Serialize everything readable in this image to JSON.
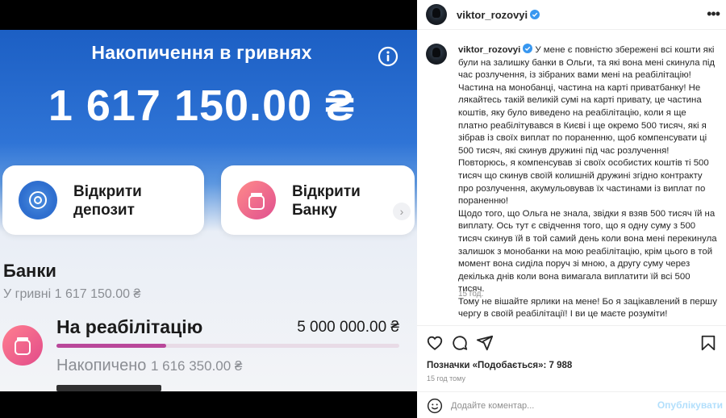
{
  "photo": {
    "title": "Накопичення в гривнях",
    "total": "1 617 150.00 ₴",
    "cards": [
      {
        "label_line1": "Відкрити",
        "label_line2": "депозит"
      },
      {
        "label_line1": "Відкрити",
        "label_line2": "Банку"
      }
    ],
    "jars_heading": "Банки",
    "jars_sub": "У гривні 1 617 150.00 ₴",
    "jar": {
      "name": "На реабілітацію",
      "goal": "5 000 000.00 ₴",
      "saved_label": "Накопичено",
      "saved_value": "1 616 350.00 ₴",
      "progress_fraction": 0.32
    }
  },
  "post": {
    "username": "viktor_rozovyi",
    "caption_lines": [
      "У мене є повністю збережені всі кошти які були на залишку банки в Ольги, та які вона мені скинула під час розлучення, із зібраних вами мені на реабілітацію!",
      "Частина на монобанці, частина на карті приватбанку! Не лякайтесь такій великій сумі на карті привату, це частина коштів, яку було виведено на реабілітацію, коли я ще платно реабілітувався в Києві і ще окремо 500 тисяч, які я зібрав із своїх виплат по пораненню, щоб компенсувати ці 500 тисяч, які скинув дружині під час розлучення!",
      "Повторюсь, я компенсував зі своїх особистих коштів ті 500 тисяч що скинув своїй колишній дружині згідно контракту про розлучення, акумульовував їх частинами із виплат по пораненню!",
      "Щодо того, що Ольга не знала, звідки я взяв 500 тисяч їй на виплату. Ось тут є свідчення того, що я одну суму з 500 тисяч скинув їй в той самий день коли вона мені перекинула залишок з монобанки на мою реабілітацію, крім цього в той момент вона сиділа поруч зі мною, а другу суму через декілька днів коли вона вимагала виплатити їй всі 500 тисяч.",
      "Тому не вішайте ярлики на мене! Бо я зацікавлений в першу чергу в своїй реабілітації! І ви це маєте розуміти!"
    ],
    "caption_age": "15 год.",
    "likes": "Позначки «Подобається»: 7 988",
    "date": "15 год тому",
    "comment_placeholder": "Додайте коментар...",
    "publish_label": "Опублікувати",
    "colors": {
      "verified": "#3897f0",
      "publish": "#b2dffc",
      "accent_blue": "#2f74d6"
    },
    "icons": [
      "heart-icon",
      "comment-icon",
      "share-icon",
      "bookmark-icon",
      "emoji-icon",
      "more-icon",
      "info-icon"
    ]
  }
}
